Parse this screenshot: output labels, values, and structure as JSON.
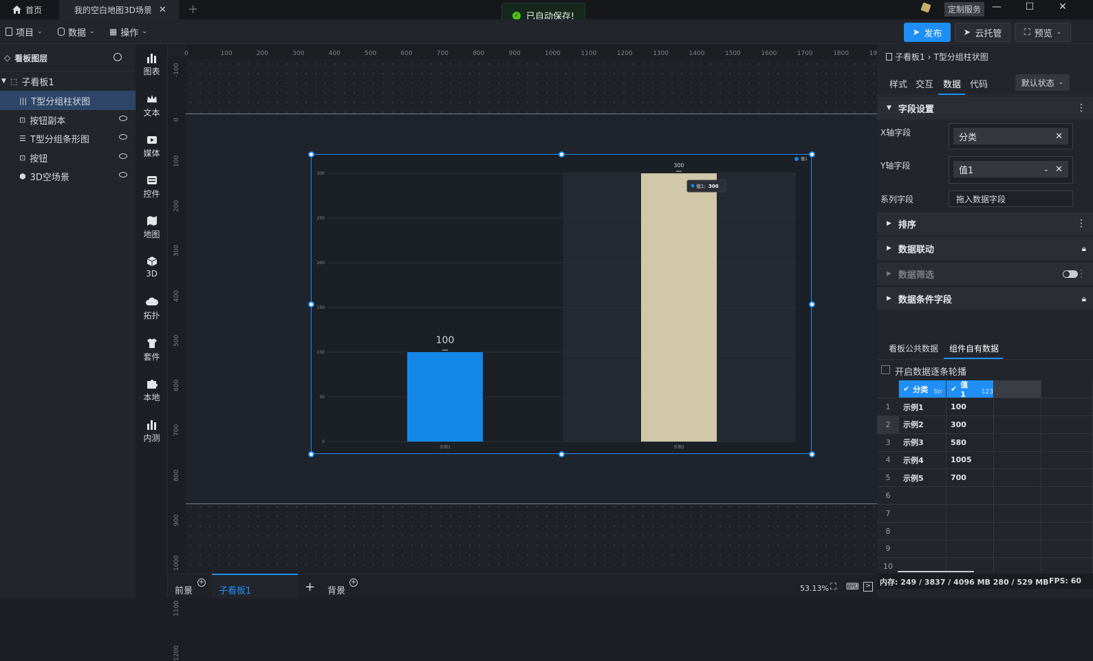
{
  "titlebar": {
    "home_tab": "首页",
    "scene_tab": "我的空白地图3D场景",
    "toast": "已自动保存!",
    "custom_service": "定制服务"
  },
  "toolbar": {
    "project": "项目",
    "data": "数据",
    "operation": "操作",
    "publish": "发布",
    "cloud": "云托管",
    "preview": "预览"
  },
  "layers": {
    "title": "看板图层",
    "items": [
      {
        "label": "子看板1"
      },
      {
        "label": "T型分组柱状图"
      },
      {
        "label": "按钮副本"
      },
      {
        "label": "T型分组条形图"
      },
      {
        "label": "按钮"
      },
      {
        "label": "3D空场景"
      }
    ]
  },
  "categories": [
    {
      "label": "图表"
    },
    {
      "label": "文本"
    },
    {
      "label": "媒体"
    },
    {
      "label": "控件"
    },
    {
      "label": "地图"
    },
    {
      "label": "3D"
    },
    {
      "label": "拓扑"
    },
    {
      "label": "套件"
    },
    {
      "label": "本地"
    },
    {
      "label": "内测"
    }
  ],
  "ruler": {
    "top": [
      "0",
      "100",
      "200",
      "300",
      "400",
      "500",
      "600",
      "700",
      "800",
      "900",
      "1000",
      "1100",
      "1200",
      "1300",
      "1400",
      "1500",
      "1600",
      "1700",
      "1800",
      "1900"
    ],
    "left": [
      "-100",
      "0",
      "100",
      "200",
      "300",
      "400",
      "500",
      "600",
      "700",
      "800",
      "900",
      "1000",
      "1100",
      "1200"
    ]
  },
  "chart_data": {
    "type": "bar",
    "categories": [
      "示例1",
      "示例2"
    ],
    "series": [
      {
        "name": "值1",
        "values": [
          100,
          300
        ]
      }
    ],
    "colors": [
      "#1488e8",
      "#d1c8aa"
    ],
    "ylim": [
      0,
      300
    ],
    "yticks": [
      "0",
      "50",
      "100",
      "150",
      "200",
      "250",
      "300"
    ],
    "data_labels": [
      "100",
      "300"
    ],
    "tooltip": {
      "label": "值1:",
      "value": "300"
    },
    "legend": "top-right"
  },
  "right": {
    "breadcrumb_parent": "子看板1",
    "breadcrumb_sep": "›",
    "breadcrumb_current": "T型分组柱状图",
    "tabs": [
      "样式",
      "交互",
      "数据",
      "代码"
    ],
    "state": "默认状态",
    "field_settings": "字段设置",
    "x_label": "X轴字段",
    "x_value": "分类",
    "y_label": "Y轴字段",
    "y_value": "值1",
    "series_label": "系列字段",
    "series_placeholder": "拖入数据字段",
    "sort": "排序",
    "linkage": "数据联动",
    "filter": "数据筛选",
    "condition": "数据条件字段",
    "data_tabs": [
      "看板公共数据",
      "组件自有数据"
    ],
    "carousel": "开启数据逐条轮播",
    "columns": [
      {
        "name": "分类",
        "type": "Str"
      },
      {
        "name": "值1",
        "type": "123"
      }
    ],
    "rows": [
      [
        "示例1",
        "100"
      ],
      [
        "示例2",
        "300"
      ],
      [
        "示例3",
        "580"
      ],
      [
        "示例4",
        "1005"
      ],
      [
        "示例5",
        "700"
      ]
    ],
    "row_numbers": [
      "1",
      "2",
      "3",
      "4",
      "5",
      "6",
      "7",
      "8",
      "9",
      "10"
    ]
  },
  "bottom": {
    "tabs": [
      "前景",
      "子看板1",
      "背景"
    ],
    "zoom": "53.13%"
  },
  "status": {
    "memory": "内存:  249 / 3837 / 4096 MB  280 / 529 MB",
    "fps": "FPS:  60"
  }
}
